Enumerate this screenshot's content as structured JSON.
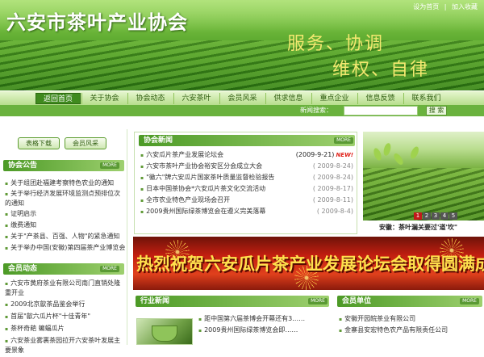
{
  "header": {
    "site_title": "六安市茶叶产业协会",
    "top_links": [
      "设为首页",
      "加入收藏"
    ],
    "top_sep": "|",
    "slogan_line1": "服务、协调",
    "slogan_line2": "维权、自律"
  },
  "nav": {
    "items": [
      "返回首页",
      "关于协会",
      "协会动态",
      "六安茶叶",
      "会员风采",
      "供求信息",
      "重点企业",
      "信息反馈",
      "联系我们"
    ],
    "active_index": 0
  },
  "search": {
    "label": "新闻搜索：",
    "value": "",
    "button_label": "搜 索"
  },
  "left": {
    "buttons": [
      "表格下载",
      "会员风采"
    ],
    "notice": {
      "title": "协会公告",
      "more": "MORE",
      "items": [
        "关于组团赴福建考察特色农业的通知",
        "关于举行经济发展环境监测点预排位次的通知",
        "证明启示",
        "缴费通知",
        "关于\"产茶县、百强、人物\"的紧急通知",
        "关于举办中国(安徽)第四届茶产业博览会"
      ]
    },
    "news": {
      "title": "会员动态",
      "more": "MORE",
      "items": [
        "六安市黄府茶业有限公司南门直销处隆重开业",
        "2009北京歙茶品鉴会举行",
        "首届\"歙六瓜片杯\"十佳青年\"",
        "茶杯奇葩 蝙蝠瓜片",
        "六安茶业雾裹茶园拉开六安茶叶发展主要景象"
      ]
    }
  },
  "center": {
    "title": "协会新闻",
    "more": "MORE",
    "items": [
      {
        "text": "六安瓜片茶产业发展论坛会",
        "date": "(2009-9-21)",
        "is_new": true
      },
      {
        "text": "六安市茶叶产业协会裕安区分会成立大会",
        "date": "( 2009-8-24)",
        "is_new": false
      },
      {
        "text": "\"徽六\"牌六安瓜片国家茶叶质量监督检验报告",
        "date": "( 2009-8-24)",
        "is_new": false
      },
      {
        "text": "日本中国茶协会*六安瓜片茶文化交流活动",
        "date": "( 2009-8-17)",
        "is_new": false
      },
      {
        "text": "全市农业特色产业现场会召开",
        "date": "( 2009-8-11)",
        "is_new": false
      },
      {
        "text": "2009贵州国际绿茶博览会在遵义完美落幕",
        "date": "( 2009-8-4)",
        "is_new": false
      }
    ],
    "new_label": "NEW!"
  },
  "photo": {
    "pages": [
      "1",
      "2",
      "3",
      "4",
      "5"
    ],
    "current_page": "1",
    "caption": "安徽：茶叶漏关要过'道'坎\""
  },
  "promo": {
    "text": "热烈祝贺六安瓜片茶产业发展论坛会取得圆满成功"
  },
  "industry": {
    "title": "行业新闻",
    "more": "MORE",
    "items": [
      "距中国第六届茶博会开幕还有3……",
      "2009贵州国际绿茶博览会即……"
    ]
  },
  "members": {
    "title": "会员单位",
    "more": "MORE",
    "items": [
      "安徽开园皖茶业有限公司",
      "金寨县安宏特色农产品有限责任公司"
    ]
  }
}
